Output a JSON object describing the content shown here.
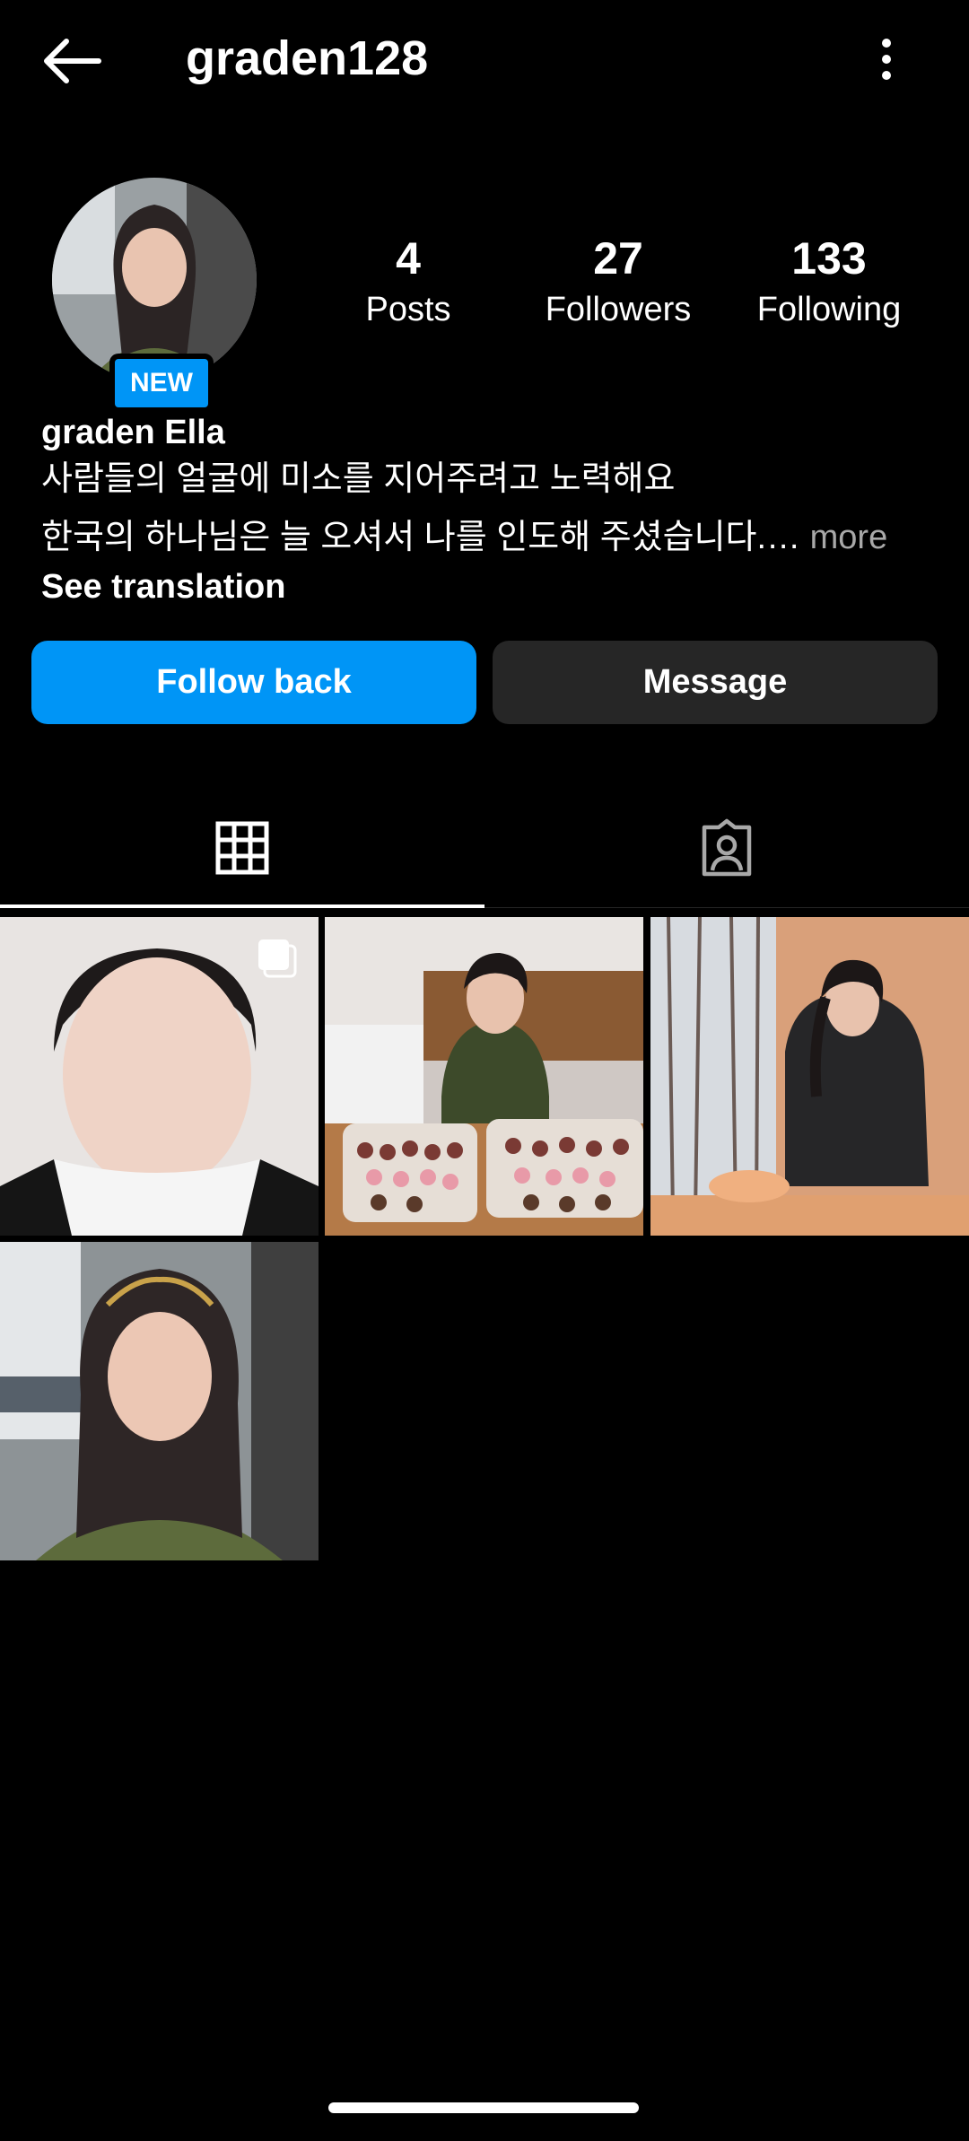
{
  "header": {
    "username": "graden128"
  },
  "profile": {
    "badge": "NEW",
    "stats": [
      {
        "value": "4",
        "label": "Posts"
      },
      {
        "value": "27",
        "label": "Followers"
      },
      {
        "value": "133",
        "label": "Following"
      }
    ],
    "full_name": "graden Ella",
    "bio_line1": "사람들의 얼굴에 미소를 지어주려고 노력해요",
    "bio_line2": "한국의 하나님은 늘 오셔서 나를 인도해 주셨습니다.…",
    "bio_more": " more",
    "see_translation": "See translation"
  },
  "actions": {
    "follow_back": "Follow back",
    "message": "Message"
  },
  "tabs": [
    {
      "icon": "grid-icon"
    },
    {
      "icon": "tagged-icon"
    }
  ],
  "posts": [
    {
      "name": "post-1",
      "multi": true
    },
    {
      "name": "post-2",
      "multi": false
    },
    {
      "name": "post-3",
      "multi": false
    },
    {
      "name": "post-4",
      "multi": false
    }
  ],
  "colors": {
    "accent": "#0095f6",
    "background": "#000000",
    "secondary_button": "#262626",
    "muted_text": "#a8a8a8"
  }
}
